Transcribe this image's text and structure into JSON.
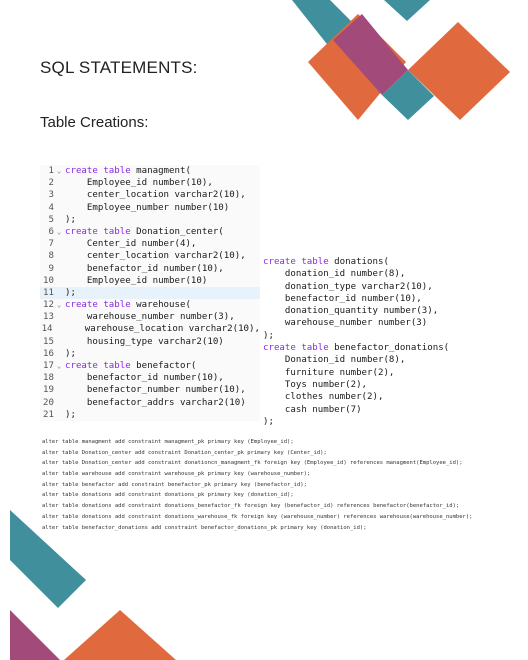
{
  "heading": "SQL STATEMENTS:",
  "subheading": "Table Creations:",
  "code_left": [
    {
      "n": "1",
      "fold": true,
      "text": "create table managment("
    },
    {
      "n": "2",
      "text": "    Employee_id number(10),"
    },
    {
      "n": "3",
      "text": "    center_location varchar2(10),"
    },
    {
      "n": "4",
      "text": "    Employee_number number(10)"
    },
    {
      "n": "5",
      "text": ");"
    },
    {
      "n": "6",
      "fold": true,
      "text": "create table Donation_center("
    },
    {
      "n": "7",
      "text": "    Center_id number(4),"
    },
    {
      "n": "8",
      "text": "    center_location varchar2(10),"
    },
    {
      "n": "9",
      "text": "    benefactor_id number(10),"
    },
    {
      "n": "10",
      "text": "    Employee_id number(10)"
    },
    {
      "n": "11",
      "text": ");",
      "highlight": true
    },
    {
      "n": "12",
      "fold": true,
      "text": "create table warehouse("
    },
    {
      "n": "13",
      "text": "    warehouse_number number(3),"
    },
    {
      "n": "14",
      "text": "    warehouse_location varchar2(10),"
    },
    {
      "n": "15",
      "text": "    housing_type varchar2(10)"
    },
    {
      "n": "16",
      "text": ");"
    },
    {
      "n": "17",
      "fold": true,
      "text": "create table benefactor("
    },
    {
      "n": "18",
      "text": "    benefactor_id number(10),"
    },
    {
      "n": "19",
      "text": "    benefactor_number number(10),"
    },
    {
      "n": "20",
      "text": "    benefactor_addrs varchar2(10)"
    },
    {
      "n": "21",
      "text": ");"
    }
  ],
  "code_right": [
    "create table donations(",
    "    donation_id number(8),",
    "    donation_type varchar2(10),",
    "    benefactor_id number(10),",
    "    donation_quantity number(3),",
    "    warehouse_number number(3)",
    ");",
    "create table benefactor_donations(",
    "    Donation_id number(8),",
    "    furniture number(2),",
    "    Toys number(2),",
    "    clothes number(2),",
    "    cash number(7)",
    ");"
  ],
  "alter_statements": [
    "alter table managment add constraint managment_pk primary key (Employee_id);",
    "alter table Donation_center add constraint Donation_center_pk primary key (Center_id);",
    "alter table Donation_center add constraint donationcn_managment_fk foreign key (Employee_id) references managment(Employee_id);",
    "alter table warehouse add constraint warehouse_pk primary key (warehouse_number);",
    "alter table benefactor add constraint benefactor_pk primary key (benefactor_id);",
    "alter table donations add constraint donations_pk primary key (donation_id);",
    "alter table donations add constraint donations_benefactor_fk foreign key (benefactor_id) references benefactor(benefactor_id);",
    "alter table donations add constraint donations_warehouse_fk foreign key (warehouse_number) references warehouse(warehouse_number);",
    "alter table benefactor_donations add constraint benefactor_donations_pk primary key (donation_id);"
  ],
  "colors": {
    "teal": "#3f8f9c",
    "orange": "#e06a3e",
    "magenta": "#a24a7a",
    "keyword": "#8a2be2"
  }
}
